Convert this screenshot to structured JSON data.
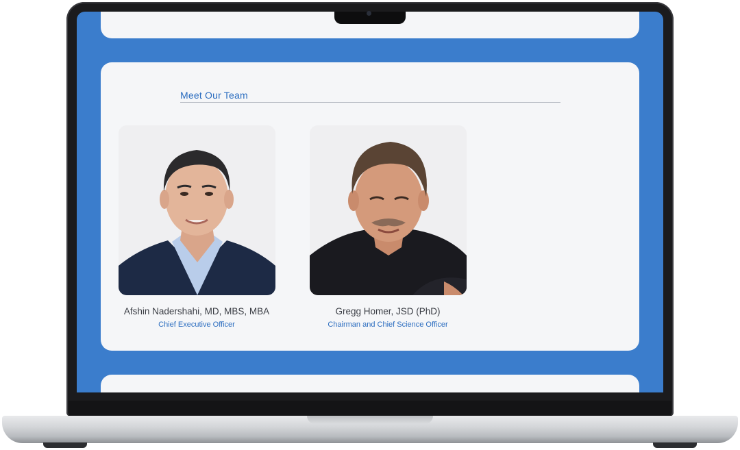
{
  "section": {
    "title": "Meet Our Team"
  },
  "team": [
    {
      "name": "Afshin Nadershahi, MD, MBS, MBA",
      "role": "Chief Executive Officer",
      "photo_icon": "portrait-photo"
    },
    {
      "name": "Gregg Homer, JSD (PhD)",
      "role": "Chairman and Chief Science Officer",
      "photo_icon": "portrait-photo"
    }
  ],
  "colors": {
    "screen_background": "#3b7dcc",
    "card_background": "#f5f6f8",
    "accent_text": "#2a6cbf",
    "name_text": "#3a3d44"
  }
}
